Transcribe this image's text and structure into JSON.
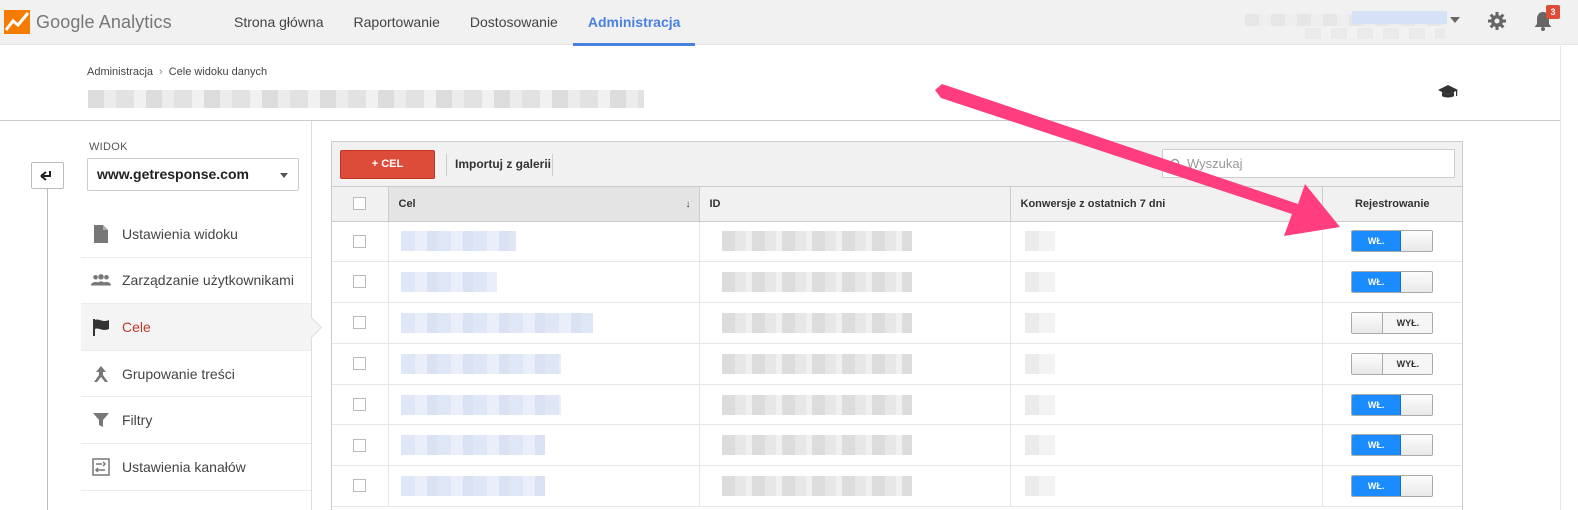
{
  "app": {
    "logo_text": "Google Analytics",
    "nav": [
      {
        "label": "Strona główna",
        "active": false
      },
      {
        "label": "Raportowanie",
        "active": false
      },
      {
        "label": "Dostosowanie",
        "active": false
      },
      {
        "label": "Administracja",
        "active": true
      }
    ],
    "notifications_count": "3"
  },
  "header": {
    "breadcrumb": [
      "Administracja",
      "Cele widoku danych"
    ]
  },
  "sidebar": {
    "section_label": "WIDOK",
    "selected_view": "www.getresponse.com",
    "items": [
      {
        "label": "Ustawienia widoku",
        "icon": "document-icon",
        "active": false
      },
      {
        "label": "Zarządzanie użytkownikami",
        "icon": "users-icon",
        "active": false
      },
      {
        "label": "Cele",
        "icon": "flag-icon",
        "active": true
      },
      {
        "label": "Grupowanie treści",
        "icon": "grouping-icon",
        "active": false
      },
      {
        "label": "Filtry",
        "icon": "filter-icon",
        "active": false
      },
      {
        "label": "Ustawienia kanałów",
        "icon": "channel-settings-icon",
        "active": false
      }
    ]
  },
  "toolbar": {
    "add_label": "+ CEL",
    "import_label": "Importuj z galerii",
    "search_placeholder": "Wyszukaj"
  },
  "table": {
    "columns": [
      "Cel",
      "ID",
      "Konwersje z ostatnich 7 dni",
      "Rejestrowanie"
    ],
    "rows": [
      {
        "recording": "WŁ.",
        "on": true
      },
      {
        "recording": "WŁ.",
        "on": true
      },
      {
        "recording": "WYŁ.",
        "on": false
      },
      {
        "recording": "WYŁ.",
        "on": false
      },
      {
        "recording": "WŁ.",
        "on": true
      },
      {
        "recording": "WŁ.",
        "on": true
      },
      {
        "recording": "WŁ.",
        "on": true
      }
    ]
  },
  "colors": {
    "accent_blue": "#4a80e0",
    "add_button_red": "#dd4b39",
    "toggle_on_blue": "#1a8cff",
    "annotation_arrow": "#ff3d7f",
    "active_item_red": "#c0392b"
  }
}
